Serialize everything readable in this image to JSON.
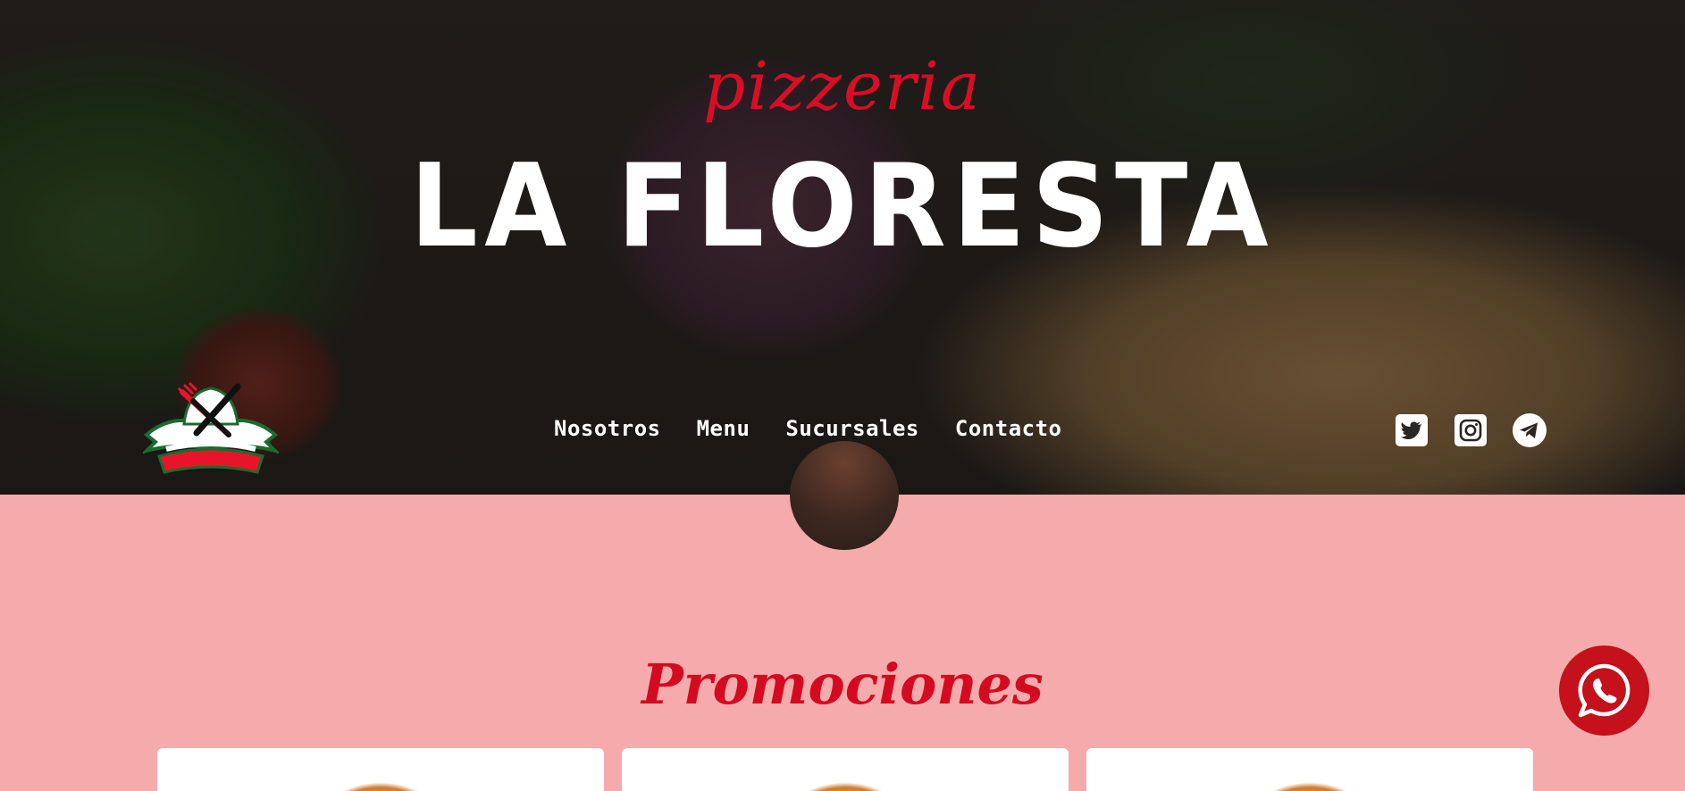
{
  "brand": {
    "tagline": "pizzeria",
    "name": "LA FLORESTA"
  },
  "nav": {
    "items": [
      {
        "label": "Nosotros"
      },
      {
        "label": "Menu"
      },
      {
        "label": "Sucursales"
      },
      {
        "label": "Contacto"
      }
    ]
  },
  "social": {
    "icons": [
      "twitter-icon",
      "instagram-icon",
      "telegram-icon"
    ]
  },
  "promotions": {
    "title": "Promociones",
    "cards": 3
  },
  "colors": {
    "accent_red": "#d80e25",
    "section_bg": "#f5abab",
    "whatsapp_bg": "#c4111b",
    "nav_text": "#ffffff"
  }
}
